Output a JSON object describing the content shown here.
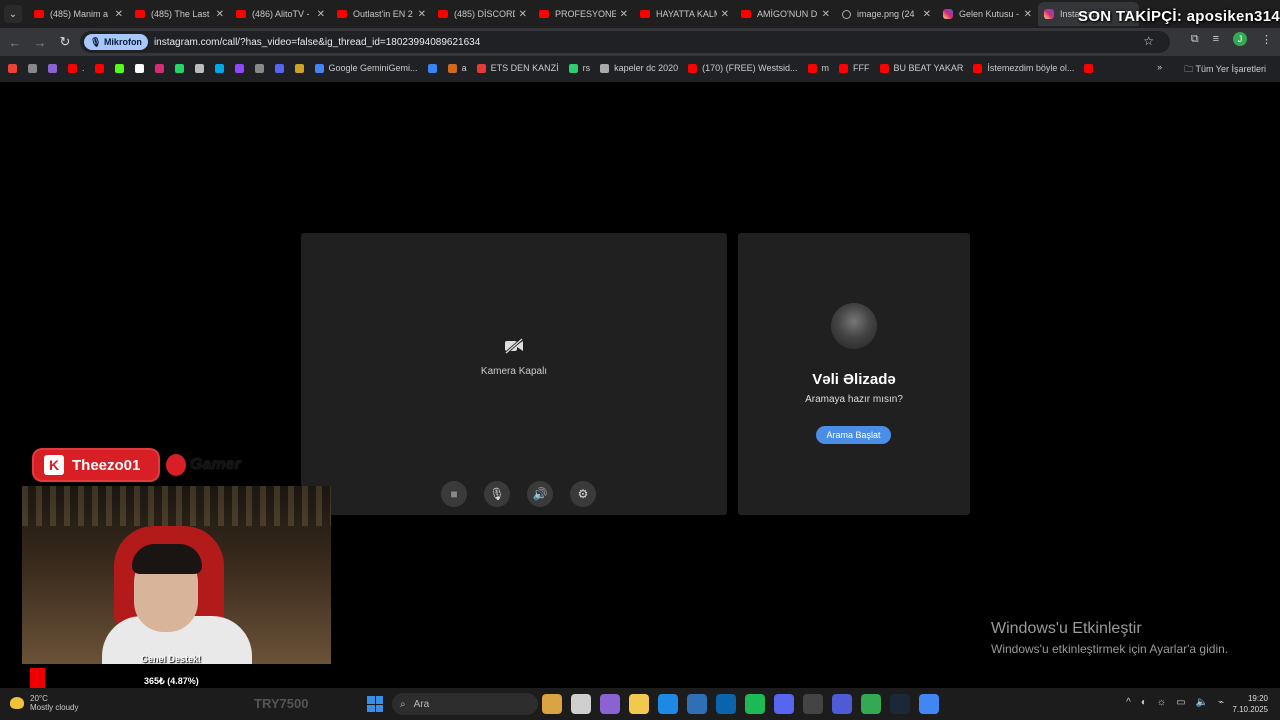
{
  "browser": {
    "tabs": [
      {
        "title": "(485) Manim a",
        "favicon": "youtube",
        "active": false
      },
      {
        "title": "(485) The Last",
        "favicon": "youtube",
        "active": false
      },
      {
        "title": "(486) AlitoTV -",
        "favicon": "youtube",
        "active": false
      },
      {
        "title": "Outlast'in EN 2",
        "favicon": "youtube",
        "active": false
      },
      {
        "title": "(485) DİSCORD",
        "favicon": "youtube",
        "active": false
      },
      {
        "title": "PROFESYONEL",
        "favicon": "youtube",
        "active": false
      },
      {
        "title": "HAYATTA KALM",
        "favicon": "youtube",
        "active": false
      },
      {
        "title": "AMİGO'NUN D",
        "favicon": "youtube",
        "active": false
      },
      {
        "title": "image.png (24",
        "favicon": "web",
        "active": false
      },
      {
        "title": "Gelen Kutusu -",
        "favicon": "instagram",
        "active": false
      },
      {
        "title": "Instagram",
        "favicon": "instagram",
        "active": true
      }
    ],
    "mic_chip": "Mikrofon",
    "url": "instagram.com/call/?has_video=false&ig_thread_id=18023994089621634",
    "profile_initial": "J",
    "bookmarks": [
      {
        "label": "",
        "color": "#ea4335"
      },
      {
        "label": "",
        "color": "#888888"
      },
      {
        "label": "",
        "color": "#8a63d2"
      },
      {
        "label": ".",
        "color": "#ff0000"
      },
      {
        "label": "",
        "color": "#ff0000"
      },
      {
        "label": "",
        "color": "#53fc18"
      },
      {
        "label": "",
        "color": "#ffffff"
      },
      {
        "label": "",
        "color": "#d62976"
      },
      {
        "label": "",
        "color": "#25d366"
      },
      {
        "label": "",
        "color": "#bbbbbb"
      },
      {
        "label": "",
        "color": "#00a8e8"
      },
      {
        "label": "",
        "color": "#9146ff"
      },
      {
        "label": "",
        "color": "#888888"
      },
      {
        "label": "",
        "color": "#5865f2"
      },
      {
        "label": "",
        "color": "#c9a227"
      },
      {
        "label": "Google GeminiGemi...",
        "color": "#4285f4"
      },
      {
        "label": "",
        "color": "#3b82f6"
      },
      {
        "label": "a",
        "color": "#d2691e"
      },
      {
        "label": "ETS DEN KANZİ",
        "color": "#e53935"
      },
      {
        "label": "rs",
        "color": "#2ecc71"
      },
      {
        "label": "kapeler dc 2020",
        "color": "#aaaaaa"
      },
      {
        "label": "(170) (FREE) Westsid...",
        "color": "#ff0000"
      },
      {
        "label": "m",
        "color": "#ff0000"
      },
      {
        "label": "FFF",
        "color": "#ff0000"
      },
      {
        "label": "BU BEAT YAKAR",
        "color": "#ff0000"
      },
      {
        "label": "İstemezdim böyle ol...",
        "color": "#ff0000"
      },
      {
        "label": "",
        "color": "#ff0000"
      }
    ],
    "all_bookmarks": "Tüm Yer İşaretleri"
  },
  "overlay": {
    "follower": "SON TAKİPÇİ: aposiken314",
    "streamer": "Theezo01",
    "sponsor": "Gamer",
    "donation_label": "Genel Destek!",
    "donation_amount": "365₺ (4.87%)",
    "donation_progress": 0.0487
  },
  "call": {
    "camera_off_label": "Kamera Kapalı",
    "peer_name": "Vəli Əlizadə",
    "peer_prompt": "Aramaya hazır mısın?",
    "start_button": "Arama Başlat"
  },
  "windows": {
    "activate_title": "Windows'u Etkinleştir",
    "activate_sub": "Windows'u etkinleştirmek için Ayarlar'a gidin.",
    "weather_temp": "20°C",
    "weather_desc": "Mostly cloudy",
    "try_overlay": "TRY7500",
    "search_placeholder": "Ara",
    "time": "19:20",
    "date": "7.10.2025"
  },
  "colors": {
    "accent_button": "#4a8ee8",
    "youtube_red": "#ff0000",
    "overlay_red": "#d81f26"
  }
}
